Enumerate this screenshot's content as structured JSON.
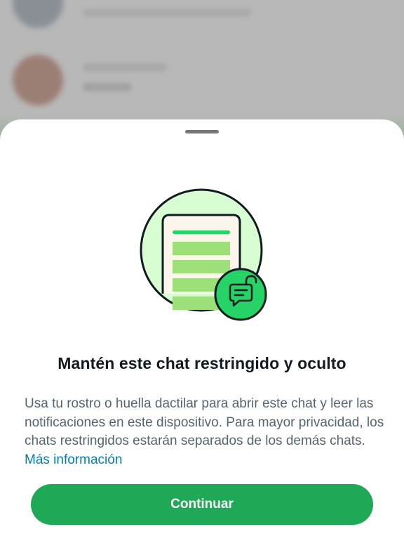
{
  "sheet": {
    "title": "Mantén este chat restringido y oculto",
    "description": "Usa tu rostro o huella dactilar para abrir este chat y leer las notificaciones en este dispositivo. Para mayor privacidad, los chats restringidos estarán separados de los demás chats.",
    "learn_more_link": "Más información",
    "continue_button": "Continuar"
  },
  "illustration": {
    "icon": "locked-chat-illustration",
    "badge_icon": "unlocked-chat-bubble-icon"
  },
  "colors": {
    "accent_green": "#1fa855",
    "link_blue": "#027eb5",
    "illustration_bg": "#d9fdd3",
    "phone_fill": "#fcf5eb"
  }
}
